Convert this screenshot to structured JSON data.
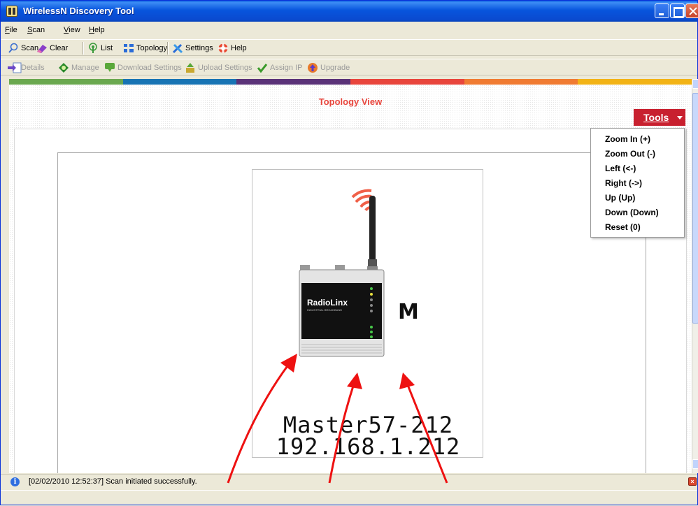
{
  "window": {
    "title": "WirelessN Discovery Tool"
  },
  "menu": {
    "items": [
      "File",
      "Scan",
      "View",
      "Help"
    ]
  },
  "toolbar1": {
    "scan": "Scan",
    "clear": "Clear",
    "list": "List",
    "topology": "Topology",
    "settings": "Settings",
    "help": "Help"
  },
  "toolbar2": {
    "details": "Details",
    "manage": "Manage",
    "download_settings": "Download Settings",
    "upload_settings": "Upload Settings",
    "assign_ip": "Assign IP",
    "upgrade": "Upgrade"
  },
  "stripe_colors": [
    "#6aa84f",
    "#1874b4",
    "#5a3278",
    "#e8453c",
    "#f07b32",
    "#f2b316"
  ],
  "main": {
    "title": "Topology View",
    "tools_label": "Tools",
    "tools_menu": [
      "Zoom In (+)",
      "Zoom Out (-)",
      "Left (<-)",
      "Right (->)",
      "Up (Up)",
      "Down (Down)",
      "Reset (0)"
    ],
    "device": {
      "brand": "RadioLinx",
      "brand_sub": "INDUSTRIAL BROADBAND",
      "role": "M",
      "name": "Master57-212",
      "ip": "192.168.1.212"
    }
  },
  "status": {
    "message": "[02/02/2010 12:52:37] Scan initiated successfully."
  }
}
